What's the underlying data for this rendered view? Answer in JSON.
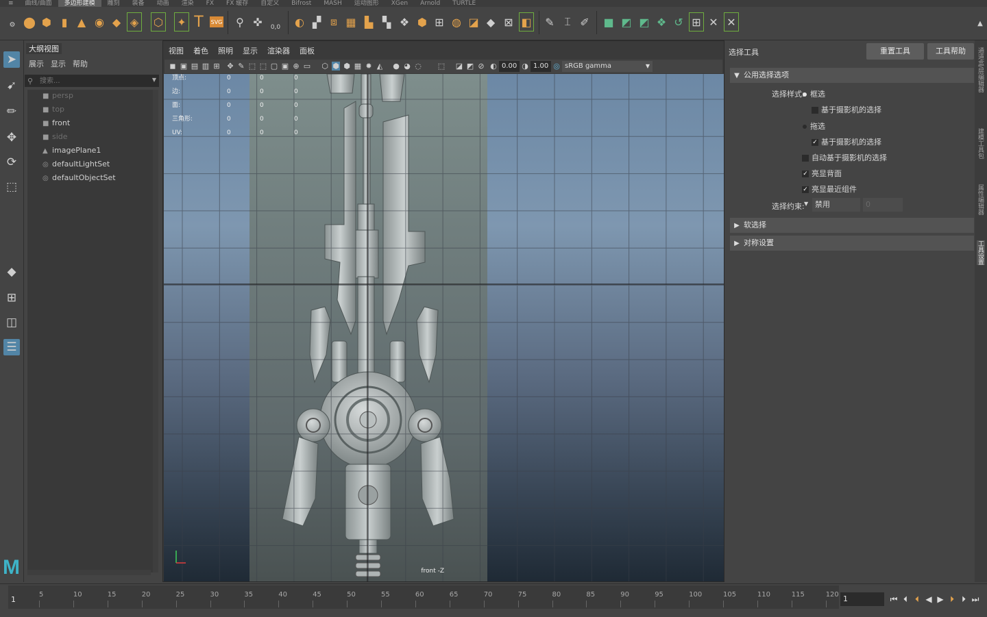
{
  "shelf_tabs": [
    "曲线/曲面",
    "多边形建模",
    "雕刻",
    "装备",
    "动画",
    "渲染",
    "FX",
    "FX 缓存",
    "自定义",
    "Bifrost",
    "MASH",
    "运动图形",
    "XGen",
    "Arnold",
    "TURTLE"
  ],
  "shelf_active": "多边形建模",
  "shelf_icons": {
    "poly_sphere": "poly-sphere-icon",
    "poly_cube": "poly-cube-icon",
    "poly_cylinder": "poly-cylinder-icon",
    "poly_cone": "poly-cone-icon",
    "poly_torus": "poly-torus-icon",
    "poly_plane": "poly-plane-icon",
    "poly_disc": "poly-disc-icon",
    "poly_platonic": "poly-platonic-icon",
    "poly_super_shape": "super-shape-icon",
    "sweep_mesh": "sweep-mesh-icon",
    "type_tool": "type-icon",
    "svg_tool": "svg-icon"
  },
  "svg_label": "SVG",
  "type_label": "T",
  "zero_label": "0,0",
  "toolbox_tools": [
    "select-tool-icon",
    "lasso-tool-icon",
    "paint-select-icon",
    "move-tool-icon",
    "rotate-tool-icon",
    "scale-tool-icon"
  ],
  "outliner": {
    "title": "大纲视图",
    "menu": [
      "展示",
      "显示",
      "帮助"
    ],
    "search_placeholder": "搜索...",
    "items": [
      {
        "label": "persp",
        "icon": "camera-icon",
        "dim": true
      },
      {
        "label": "top",
        "icon": "camera-icon",
        "dim": true
      },
      {
        "label": "front",
        "icon": "camera-icon",
        "dim": false
      },
      {
        "label": "side",
        "icon": "camera-icon",
        "dim": true
      },
      {
        "label": "imagePlane1",
        "icon": "image-plane-icon",
        "dim": false
      },
      {
        "label": "defaultLightSet",
        "icon": "set-icon",
        "dim": false
      },
      {
        "label": "defaultObjectSet",
        "icon": "set-icon",
        "dim": false
      }
    ]
  },
  "viewport": {
    "menu": [
      "视图",
      "着色",
      "照明",
      "显示",
      "渲染器",
      "面板"
    ],
    "exposure": "0.00",
    "gamma": "1.00",
    "color_space": "sRGB gamma",
    "camera_label": "front -Z",
    "hud": [
      {
        "label": "顶点:",
        "v1": "0",
        "v2": "0",
        "v3": "0"
      },
      {
        "label": "边:",
        "v1": "0",
        "v2": "0",
        "v3": "0"
      },
      {
        "label": "面:",
        "v1": "0",
        "v2": "0",
        "v3": "0"
      },
      {
        "label": "三角形:",
        "v1": "0",
        "v2": "0",
        "v3": "0"
      },
      {
        "label": "UV:",
        "v1": "0",
        "v2": "0",
        "v3": "0"
      }
    ]
  },
  "attr_panel": {
    "title": "选择工具",
    "reset_button": "重置工具",
    "help_button": "工具帮助",
    "section_common": "公用选择选项",
    "selection_style_label": "选择样式:",
    "marquee": "框选",
    "camera_based_1": "基于摄影机的选择",
    "drag": "拖选",
    "camera_based_2": "基于摄影机的选择",
    "auto_camera": "自动基于摄影机的选择",
    "highlight_backfaces": "亮显背面",
    "highlight_nearest": "亮显最近组件",
    "constraint_label": "选择约束:",
    "constraint_value": "禁用",
    "constraint_num": "0",
    "section_soft": "软选择",
    "section_symmetry": "对称设置"
  },
  "side_tabs": [
    "通道盒/层编辑器",
    "建模工具包",
    "属性编辑器",
    "工具设置"
  ],
  "timeline": {
    "ticks": [
      "5",
      "10",
      "15",
      "20",
      "25",
      "30",
      "35",
      "40",
      "45",
      "50",
      "55",
      "60",
      "65",
      "70",
      "75",
      "80",
      "85",
      "90",
      "95",
      "100",
      "105",
      "110",
      "115",
      "120"
    ],
    "current_frame": "1",
    "frame_field": "1"
  },
  "logo": "M"
}
